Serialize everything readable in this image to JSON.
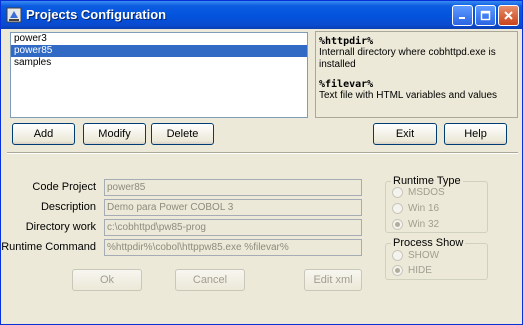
{
  "window": {
    "title": "Projects Configuration"
  },
  "titlebar_buttons": [
    "minimize-icon",
    "maximize-icon",
    "close-icon"
  ],
  "projects": {
    "items": [
      {
        "label": "power3",
        "selected": false
      },
      {
        "label": "power85",
        "selected": true
      },
      {
        "label": "samples",
        "selected": false
      }
    ]
  },
  "help": {
    "entries": [
      {
        "term": "%httpdir%",
        "description": "Internall directory where cobhttpd.exe is installed"
      },
      {
        "term": "%filevar%",
        "description": "Text file with HTML variables and values"
      }
    ]
  },
  "toolbar": {
    "add_label": "Add",
    "modify_label": "Modify",
    "delete_label": "Delete",
    "exit_label": "Exit",
    "help_label": "Help"
  },
  "form": {
    "code_project": {
      "label": "Code Project",
      "value": "power85"
    },
    "description": {
      "label": "Description",
      "value": "Demo para Power COBOL 3"
    },
    "directory_work": {
      "label": "Directory work",
      "value": "c:\\cobhttpd\\pw85-prog"
    },
    "runtime_command": {
      "label": "Runtime Command",
      "value": "%httpdir%\\cobol\\httppw85.exe %filevar%"
    }
  },
  "runtime_type": {
    "title": "Runtime Type",
    "options": [
      {
        "label": "MSDOS",
        "checked": false
      },
      {
        "label": "Win 16",
        "checked": false
      },
      {
        "label": "Win 32",
        "checked": true
      }
    ]
  },
  "process_show": {
    "title": "Process Show",
    "options": [
      {
        "label": "SHOW",
        "checked": false
      },
      {
        "label": "HIDE",
        "checked": true
      }
    ]
  },
  "bottom_buttons": {
    "ok_label": "Ok",
    "cancel_label": "Cancel",
    "edit_xml_label": "Edit xml"
  },
  "colors": {
    "titlebar": "#0353dd",
    "selection": "#316ac5",
    "window_bg": "#ece9d8",
    "disabled_text": "#a19e8f"
  }
}
